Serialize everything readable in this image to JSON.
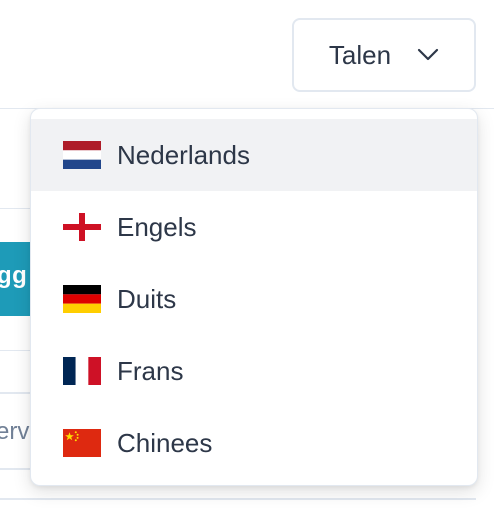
{
  "language_button": {
    "label": "Talen",
    "icon": "chevron-down-icon"
  },
  "background": {
    "teal_button_text": "gg",
    "input_text": "erv",
    "accent_color": "#1e9bb8"
  },
  "menu": {
    "items": [
      {
        "label": "Nederlands",
        "flag": "netherlands-flag-icon",
        "active": true
      },
      {
        "label": "Engels",
        "flag": "england-flag-icon",
        "active": false
      },
      {
        "label": "Duits",
        "flag": "germany-flag-icon",
        "active": false
      },
      {
        "label": "Frans",
        "flag": "france-flag-icon",
        "active": false
      },
      {
        "label": "Chinees",
        "flag": "china-flag-icon",
        "active": false
      }
    ]
  }
}
